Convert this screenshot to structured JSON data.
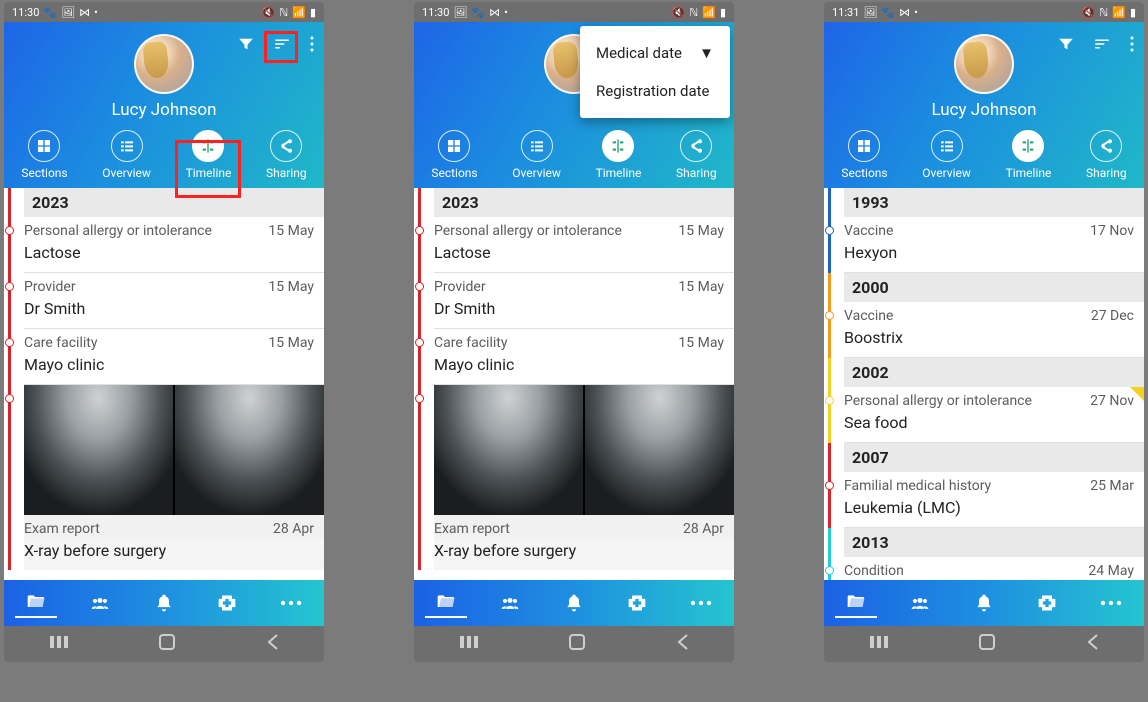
{
  "status": {
    "time_a": "11:30",
    "time_c": "11:31",
    "icons_left": [
      "paw",
      "picture",
      "link"
    ],
    "icons_right": [
      "mute",
      "nfc",
      "wifi",
      "signal",
      "battery"
    ]
  },
  "header": {
    "patient_name": "Lucy Johnson",
    "actions": {
      "filter": "filter-icon",
      "sort": "sort-icon",
      "overflow": "overflow-icon"
    },
    "tabs": [
      {
        "key": "sections",
        "label": "Sections",
        "icon": "grid-icon",
        "active": false
      },
      {
        "key": "overview",
        "label": "Overview",
        "icon": "list-icon",
        "active": false
      },
      {
        "key": "timeline",
        "label": "Timeline",
        "icon": "timeline-icon",
        "active": true
      },
      {
        "key": "sharing",
        "label": "Sharing",
        "icon": "share-icon",
        "active": false
      }
    ]
  },
  "sort_menu": {
    "options": [
      {
        "label": "Medical date",
        "selected": true
      },
      {
        "label": "Registration date",
        "selected": false
      }
    ]
  },
  "timeline_a": [
    {
      "type": "year",
      "text": "2023",
      "color": "red"
    },
    {
      "type": "entry",
      "label": "Personal allergy or intolerance",
      "date": "15 May",
      "value": "Lactose",
      "color": "red"
    },
    {
      "type": "entry",
      "label": "Provider",
      "date": "15 May",
      "value": "Dr Smith",
      "color": "red"
    },
    {
      "type": "entry",
      "label": "Care facility",
      "date": "15 May",
      "value": "Mayo clinic",
      "color": "red"
    },
    {
      "type": "xray",
      "label": "Exam report",
      "date": "28 Apr",
      "value": "X-ray before surgery",
      "color": "red"
    }
  ],
  "timeline_c": [
    {
      "type": "year",
      "text": "1993",
      "color": "blue"
    },
    {
      "type": "entry",
      "label": "Vaccine",
      "date": "17 Nov",
      "value": "Hexyon",
      "color": "blue"
    },
    {
      "type": "year",
      "text": "2000",
      "color": "orange"
    },
    {
      "type": "entry",
      "label": "Vaccine",
      "date": "27 Dec",
      "value": "Boostrix",
      "color": "orange"
    },
    {
      "type": "year",
      "text": "2002",
      "color": "yellow"
    },
    {
      "type": "entry",
      "label": "Personal allergy or intolerance",
      "date": "27 Nov",
      "value": "Sea food",
      "color": "yellow",
      "flag": true
    },
    {
      "type": "year",
      "text": "2007",
      "color": "red"
    },
    {
      "type": "entry",
      "label": "Familial medical history",
      "date": "25 Mar",
      "value": "Leukemia (LMC)",
      "color": "red"
    },
    {
      "type": "year",
      "text": "2013",
      "color": "cyan"
    },
    {
      "type": "entry",
      "label": "Condition",
      "date": "24 May",
      "value": "",
      "color": "cyan"
    }
  ],
  "bottombar": [
    "folder-open-icon",
    "people-icon",
    "bell-icon",
    "medical-cross-icon",
    "more-icon"
  ],
  "navbar": [
    "recent-icon",
    "home-icon",
    "back-icon"
  ]
}
